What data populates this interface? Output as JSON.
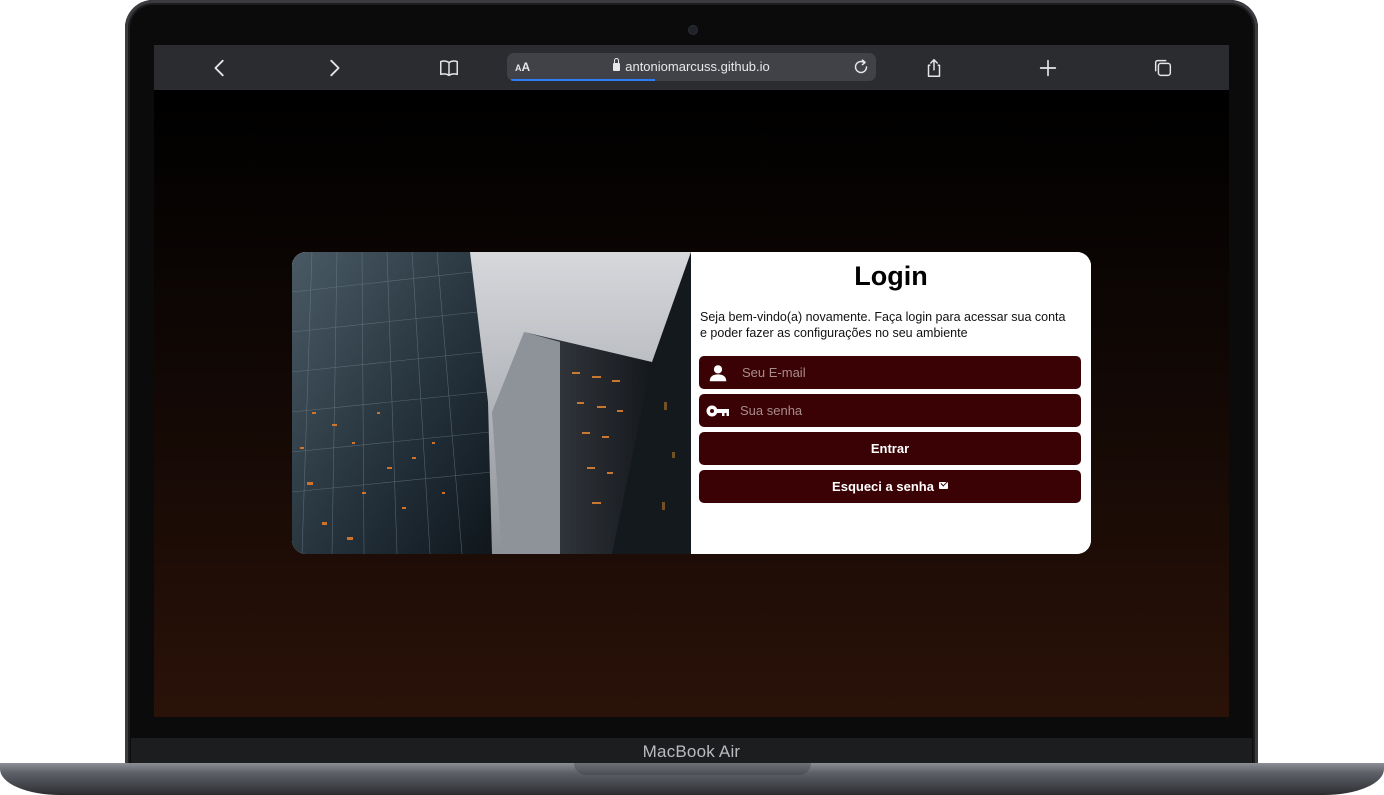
{
  "device": {
    "label": "MacBook Air"
  },
  "browser": {
    "url": "antoniomarcuss.github.io",
    "reader_label": "AA",
    "load_progress": 0.39
  },
  "login": {
    "title": "Login",
    "description": "Seja bem-vindo(a) novamente. Faça login para acessar sua conta e poder fazer as configurações no seu ambiente",
    "email_placeholder": "Seu E-mail",
    "password_placeholder": "Sua senha",
    "submit_label": "Entrar",
    "forgot_label": "Esqueci a senha"
  },
  "colors": {
    "accent": "#3a0204",
    "background_top": "#000000",
    "background_bottom": "#2a1208"
  }
}
